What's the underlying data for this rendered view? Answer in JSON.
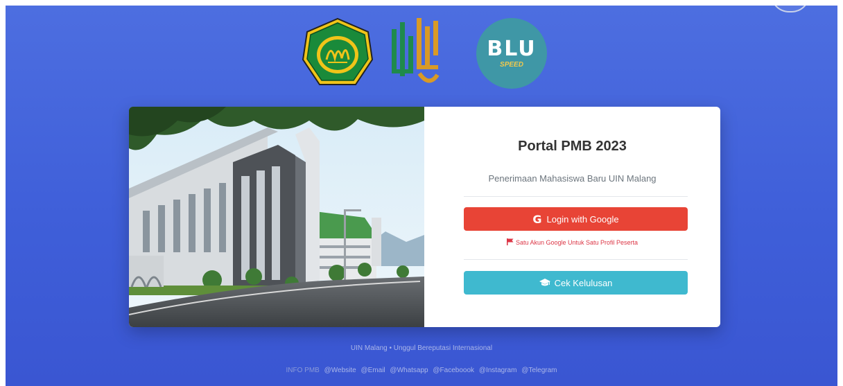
{
  "logos": {
    "blu_main": "BLU",
    "blu_sub": "SPEED"
  },
  "portal": {
    "title": "Portal PMB 2023",
    "subtitle": "Penerimaan Mahasiswa Baru UIN Malang",
    "google_button_label": "Login with Google",
    "google_note": "Satu Akun Google Untuk Satu Profil Peserta",
    "cek_button_label": "Cek Kelulusan"
  },
  "footer": {
    "tagline": "UIN Malang • Unggul Bereputasi Internasional",
    "info_label": "INFO PMB",
    "links": [
      "@Website",
      "@Email",
      "@Whatsapp",
      "@Faceboook",
      "@Instagram",
      "@Telegram"
    ]
  },
  "colors": {
    "background": "#4362da",
    "google_button": "#e84436",
    "cek_button": "#3fb9cf",
    "note_text": "#dc3545"
  },
  "icons": [
    "google-g-icon",
    "flag-icon",
    "graduation-cap-icon"
  ]
}
